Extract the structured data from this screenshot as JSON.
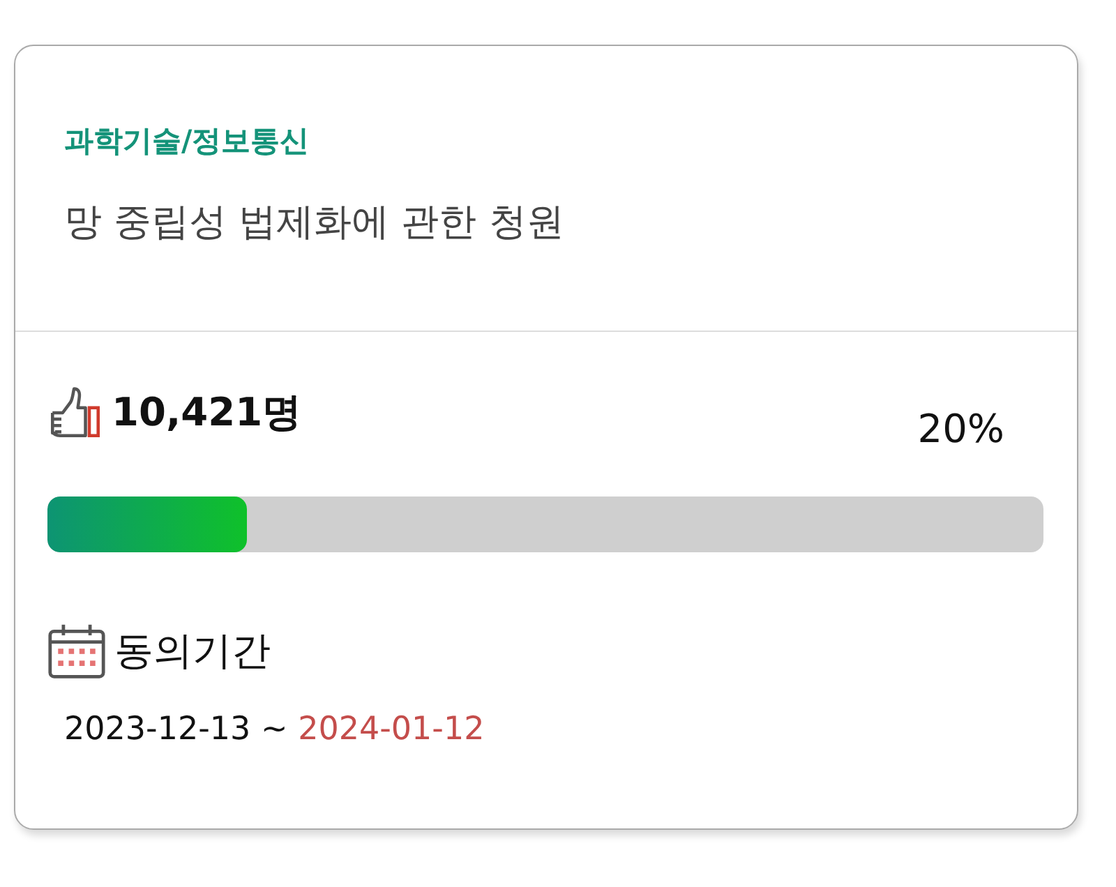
{
  "petition": {
    "category": "과학기술/정보통신",
    "title": "망 중립성 법제화에 관한 청원"
  },
  "agreement": {
    "count": "10,421명",
    "percent": "20%",
    "level": 0.2
  },
  "period": {
    "label": "동의기간",
    "start": "2023-12-13",
    "separator": "~",
    "end": "2024-01-12"
  }
}
